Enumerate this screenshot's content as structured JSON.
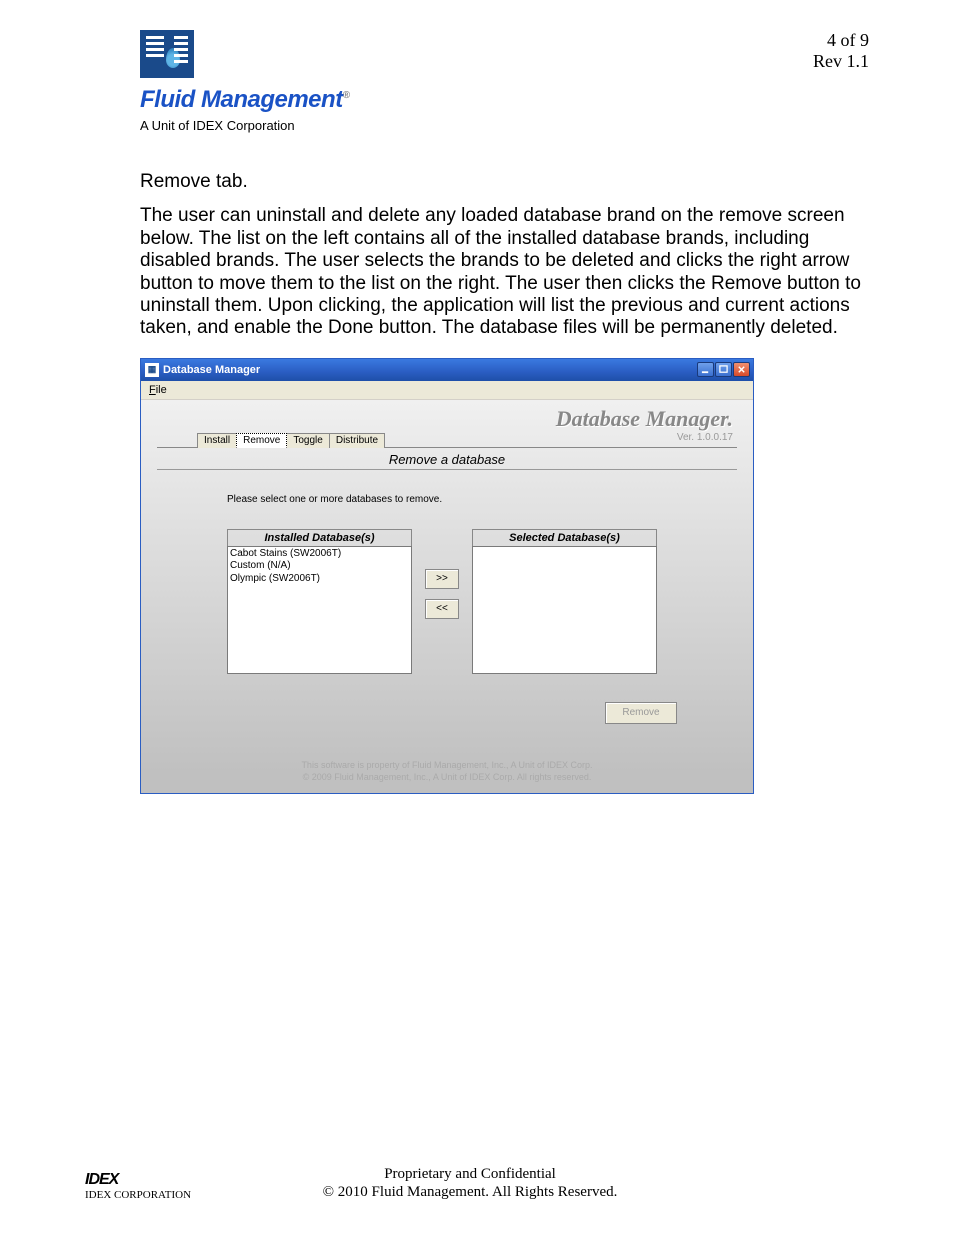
{
  "header": {
    "brand": "Fluid Management",
    "brand_reg": "®",
    "brand_sub": "A Unit of IDEX Corporation",
    "page_of": "4 of 9",
    "rev": "Rev 1.1"
  },
  "body": {
    "heading": "Remove tab.",
    "paragraph": "The user can uninstall and delete any loaded database brand on the remove screen below.  The list on the left contains all of the installed database brands, including disabled brands.  The user selects the brands to be deleted and clicks the right arrow button to move them to the list on the right.  The user then clicks the Remove button to uninstall them.  Upon clicking, the application will list the previous and current actions taken, and enable the Done button.  The database files will be permanently deleted."
  },
  "app": {
    "title": "Database Manager",
    "menu_file": "File",
    "menu_file_key": "F",
    "heading": "Database Manager.",
    "version": "Ver. 1.0.0.17",
    "tabs": {
      "install": "Install",
      "remove": "Remove",
      "toggle": "Toggle",
      "distribute": "Distribute"
    },
    "subtitle": "Remove a database",
    "instruction": "Please select one or more databases to remove.",
    "installed_head": "Installed Database(s)",
    "selected_head": "Selected Database(s)",
    "installed_items": [
      "Cabot Stains (SW2006T)",
      "Custom (N/A)",
      "Olympic (SW2006T)"
    ],
    "arrow_right": ">>",
    "arrow_left": "<<",
    "remove_btn": "Remove",
    "legal1": "This software is property of Fluid Management, Inc., A Unit of IDEX Corp.",
    "legal2": "© 2009 Fluid Management, Inc., A Unit of IDEX Corp.  All rights reserved."
  },
  "footer": {
    "logo": "IDEX",
    "logo_sub": "IDEX CORPORATION",
    "line1": "Proprietary and Confidential",
    "line2": "© 2010 Fluid Management. All Rights Reserved."
  }
}
